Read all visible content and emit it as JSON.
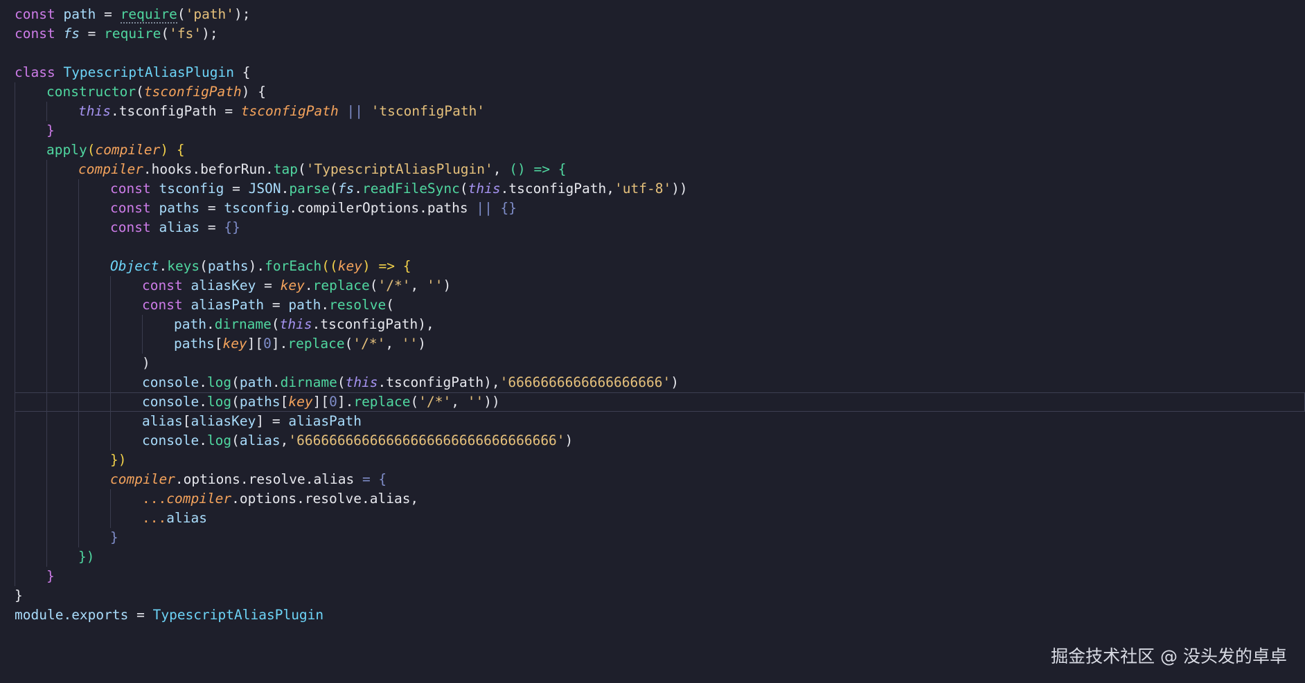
{
  "editor": {
    "language": "javascript",
    "highlighted_line": 20,
    "colors": {
      "background": "#1e1f2b",
      "keyword": "#cd7ce8",
      "string": "#e5c07b",
      "function": "#50d7a0",
      "parameter": "#f4a35c",
      "variable": "#a9dcfb",
      "class": "#6dd4f7",
      "this": "#a593f0",
      "text": "#e7e8ee",
      "punctuation": "#7f8dc9",
      "bracket": "#f1d04a"
    },
    "lines": [
      {
        "indent": 0,
        "tokens": [
          {
            "t": "const ",
            "c": "keyword"
          },
          {
            "t": "path",
            "c": "variable"
          },
          {
            "t": " = ",
            "c": "text"
          },
          {
            "t": "require",
            "c": "function",
            "s": "squiggle"
          },
          {
            "t": "(",
            "c": "text"
          },
          {
            "t": "'path'",
            "c": "string"
          },
          {
            "t": ");",
            "c": "text"
          }
        ]
      },
      {
        "indent": 0,
        "tokens": [
          {
            "t": "const ",
            "c": "keyword"
          },
          {
            "t": "fs",
            "c": "variable",
            "s": "it"
          },
          {
            "t": " = ",
            "c": "text"
          },
          {
            "t": "require",
            "c": "function"
          },
          {
            "t": "(",
            "c": "text"
          },
          {
            "t": "'fs'",
            "c": "string"
          },
          {
            "t": ");",
            "c": "text"
          }
        ]
      },
      {
        "indent": 0,
        "tokens": []
      },
      {
        "indent": 0,
        "tokens": [
          {
            "t": "class ",
            "c": "keyword"
          },
          {
            "t": "TypescriptAliasPlugin",
            "c": "class"
          },
          {
            "t": " {",
            "c": "text"
          }
        ]
      },
      {
        "indent": 1,
        "tokens": [
          {
            "t": "constructor",
            "c": "function"
          },
          {
            "t": "(",
            "c": "text"
          },
          {
            "t": "tsconfigPath",
            "c": "parameter",
            "s": "it"
          },
          {
            "t": ") {",
            "c": "text"
          }
        ]
      },
      {
        "indent": 2,
        "tokens": [
          {
            "t": "this",
            "c": "this",
            "s": "it"
          },
          {
            "t": ".tsconfigPath",
            "c": "text"
          },
          {
            "t": " = ",
            "c": "text"
          },
          {
            "t": "tsconfigPath",
            "c": "parameter",
            "s": "it"
          },
          {
            "t": " || ",
            "c": "punctuation"
          },
          {
            "t": "'tsconfigPath'",
            "c": "string"
          }
        ]
      },
      {
        "indent": 1,
        "tokens": [
          {
            "t": "}",
            "c": "keyword"
          }
        ]
      },
      {
        "indent": 1,
        "tokens": [
          {
            "t": "apply",
            "c": "function"
          },
          {
            "t": "(",
            "c": "bracket"
          },
          {
            "t": "compiler",
            "c": "parameter",
            "s": "it"
          },
          {
            "t": ") {",
            "c": "bracket"
          }
        ]
      },
      {
        "indent": 2,
        "tokens": [
          {
            "t": "compiler",
            "c": "parameter",
            "s": "it"
          },
          {
            "t": ".hooks.beforRun.",
            "c": "text"
          },
          {
            "t": "tap",
            "c": "function"
          },
          {
            "t": "(",
            "c": "text"
          },
          {
            "t": "'TypescriptAliasPlugin'",
            "c": "string"
          },
          {
            "t": ", ",
            "c": "text"
          },
          {
            "t": "() => {",
            "c": "function"
          }
        ]
      },
      {
        "indent": 3,
        "tokens": [
          {
            "t": "const ",
            "c": "keyword"
          },
          {
            "t": "tsconfig",
            "c": "variable"
          },
          {
            "t": " = ",
            "c": "text"
          },
          {
            "t": "JSON",
            "c": "variable"
          },
          {
            "t": ".",
            "c": "text"
          },
          {
            "t": "parse",
            "c": "function"
          },
          {
            "t": "(",
            "c": "text"
          },
          {
            "t": "fs",
            "c": "variable",
            "s": "it"
          },
          {
            "t": ".",
            "c": "text"
          },
          {
            "t": "readFileSync",
            "c": "function"
          },
          {
            "t": "(",
            "c": "text"
          },
          {
            "t": "this",
            "c": "this",
            "s": "it"
          },
          {
            "t": ".tsconfigPath,",
            "c": "text"
          },
          {
            "t": "'utf-8'",
            "c": "string"
          },
          {
            "t": "))",
            "c": "text"
          }
        ]
      },
      {
        "indent": 3,
        "tokens": [
          {
            "t": "const ",
            "c": "keyword"
          },
          {
            "t": "paths",
            "c": "variable"
          },
          {
            "t": " = ",
            "c": "text"
          },
          {
            "t": "tsconfig",
            "c": "variable"
          },
          {
            "t": ".compilerOptions.paths",
            "c": "text"
          },
          {
            "t": " || {}",
            "c": "punctuation"
          }
        ]
      },
      {
        "indent": 3,
        "tokens": [
          {
            "t": "const ",
            "c": "keyword"
          },
          {
            "t": "alias",
            "c": "variable"
          },
          {
            "t": " = ",
            "c": "text"
          },
          {
            "t": "{}",
            "c": "punctuation"
          }
        ]
      },
      {
        "indent": 0,
        "tokens": []
      },
      {
        "indent": 3,
        "tokens": [
          {
            "t": "Object",
            "c": "class",
            "s": "it"
          },
          {
            "t": ".",
            "c": "text"
          },
          {
            "t": "keys",
            "c": "function"
          },
          {
            "t": "(",
            "c": "text"
          },
          {
            "t": "paths",
            "c": "variable"
          },
          {
            "t": ").",
            "c": "text"
          },
          {
            "t": "forEach",
            "c": "function"
          },
          {
            "t": "((",
            "c": "bracket"
          },
          {
            "t": "key",
            "c": "parameter",
            "s": "it"
          },
          {
            "t": ") => {",
            "c": "bracket"
          }
        ]
      },
      {
        "indent": 4,
        "tokens": [
          {
            "t": "const ",
            "c": "keyword"
          },
          {
            "t": "aliasKey",
            "c": "variable"
          },
          {
            "t": " = ",
            "c": "text"
          },
          {
            "t": "key",
            "c": "parameter",
            "s": "it"
          },
          {
            "t": ".",
            "c": "text"
          },
          {
            "t": "replace",
            "c": "function"
          },
          {
            "t": "(",
            "c": "text"
          },
          {
            "t": "'/*'",
            "c": "string"
          },
          {
            "t": ", ",
            "c": "text"
          },
          {
            "t": "''",
            "c": "string"
          },
          {
            "t": ")",
            "c": "text"
          }
        ]
      },
      {
        "indent": 4,
        "tokens": [
          {
            "t": "const ",
            "c": "keyword"
          },
          {
            "t": "aliasPath",
            "c": "variable"
          },
          {
            "t": " = ",
            "c": "text"
          },
          {
            "t": "path",
            "c": "variable"
          },
          {
            "t": ".",
            "c": "text"
          },
          {
            "t": "resolve",
            "c": "function"
          },
          {
            "t": "(",
            "c": "text"
          }
        ]
      },
      {
        "indent": 5,
        "tokens": [
          {
            "t": "path",
            "c": "variable"
          },
          {
            "t": ".",
            "c": "text"
          },
          {
            "t": "dirname",
            "c": "function"
          },
          {
            "t": "(",
            "c": "text"
          },
          {
            "t": "this",
            "c": "this",
            "s": "it"
          },
          {
            "t": ".tsconfigPath",
            "c": "text"
          },
          {
            "t": "),",
            "c": "text"
          }
        ]
      },
      {
        "indent": 5,
        "tokens": [
          {
            "t": "paths",
            "c": "variable"
          },
          {
            "t": "[",
            "c": "text"
          },
          {
            "t": "key",
            "c": "parameter",
            "s": "it"
          },
          {
            "t": "][",
            "c": "text"
          },
          {
            "t": "0",
            "c": "punctuation"
          },
          {
            "t": "].",
            "c": "text"
          },
          {
            "t": "replace",
            "c": "function"
          },
          {
            "t": "(",
            "c": "text"
          },
          {
            "t": "'/*'",
            "c": "string"
          },
          {
            "t": ", ",
            "c": "text"
          },
          {
            "t": "''",
            "c": "string"
          },
          {
            "t": ")",
            "c": "text"
          }
        ]
      },
      {
        "indent": 4,
        "tokens": [
          {
            "t": ")",
            "c": "text"
          }
        ]
      },
      {
        "indent": 4,
        "tokens": [
          {
            "t": "console",
            "c": "variable"
          },
          {
            "t": ".",
            "c": "text"
          },
          {
            "t": "log",
            "c": "function"
          },
          {
            "t": "(",
            "c": "text"
          },
          {
            "t": "path",
            "c": "variable"
          },
          {
            "t": ".",
            "c": "text"
          },
          {
            "t": "dirname",
            "c": "function"
          },
          {
            "t": "(",
            "c": "text"
          },
          {
            "t": "this",
            "c": "this",
            "s": "it"
          },
          {
            "t": ".tsconfigPath",
            "c": "text"
          },
          {
            "t": "),",
            "c": "text"
          },
          {
            "t": "'6666666666666666666'",
            "c": "string"
          },
          {
            "t": ")",
            "c": "text"
          }
        ]
      },
      {
        "indent": 4,
        "tokens": [
          {
            "t": "console",
            "c": "variable"
          },
          {
            "t": ".",
            "c": "text"
          },
          {
            "t": "log",
            "c": "function"
          },
          {
            "t": "(",
            "c": "text"
          },
          {
            "t": "paths",
            "c": "variable"
          },
          {
            "t": "[",
            "c": "text"
          },
          {
            "t": "key",
            "c": "parameter",
            "s": "it"
          },
          {
            "t": "][",
            "c": "text"
          },
          {
            "t": "0",
            "c": "punctuation"
          },
          {
            "t": "].",
            "c": "text"
          },
          {
            "t": "replace",
            "c": "function"
          },
          {
            "t": "(",
            "c": "text"
          },
          {
            "t": "'/*'",
            "c": "string"
          },
          {
            "t": ", ",
            "c": "text"
          },
          {
            "t": "''",
            "c": "string"
          },
          {
            "t": "))",
            "c": "text"
          }
        ]
      },
      {
        "indent": 4,
        "tokens": [
          {
            "t": "alias",
            "c": "variable"
          },
          {
            "t": "[",
            "c": "text"
          },
          {
            "t": "aliasKey",
            "c": "variable"
          },
          {
            "t": "]",
            "c": "text"
          },
          {
            "t": " = ",
            "c": "text"
          },
          {
            "t": "aliasPath",
            "c": "variable"
          }
        ]
      },
      {
        "indent": 4,
        "tokens": [
          {
            "t": "console",
            "c": "variable"
          },
          {
            "t": ".",
            "c": "text"
          },
          {
            "t": "log",
            "c": "function"
          },
          {
            "t": "(",
            "c": "text"
          },
          {
            "t": "alias",
            "c": "variable"
          },
          {
            "t": ",",
            "c": "text"
          },
          {
            "t": "'66666666666666666666666666666666'",
            "c": "string"
          },
          {
            "t": ")",
            "c": "text"
          }
        ]
      },
      {
        "indent": 3,
        "tokens": [
          {
            "t": "})",
            "c": "bracket"
          }
        ]
      },
      {
        "indent": 3,
        "tokens": [
          {
            "t": "compiler",
            "c": "parameter",
            "s": "it"
          },
          {
            "t": ".options.resolve.alias",
            "c": "text"
          },
          {
            "t": " = {",
            "c": "punctuation"
          }
        ]
      },
      {
        "indent": 4,
        "tokens": [
          {
            "t": "...",
            "c": "parameter"
          },
          {
            "t": "compiler",
            "c": "parameter",
            "s": "it"
          },
          {
            "t": ".options.resolve.alias,",
            "c": "text"
          }
        ]
      },
      {
        "indent": 4,
        "tokens": [
          {
            "t": "...",
            "c": "parameter"
          },
          {
            "t": "alias",
            "c": "variable"
          }
        ]
      },
      {
        "indent": 3,
        "tokens": [
          {
            "t": "}",
            "c": "punctuation"
          }
        ]
      },
      {
        "indent": 2,
        "tokens": [
          {
            "t": "})",
            "c": "function"
          }
        ]
      },
      {
        "indent": 1,
        "tokens": [
          {
            "t": "}",
            "c": "keyword"
          }
        ]
      },
      {
        "indent": 0,
        "tokens": [
          {
            "t": "}",
            "c": "text"
          }
        ]
      },
      {
        "indent": 0,
        "tokens": [
          {
            "t": "module",
            "c": "variable"
          },
          {
            "t": ".exports",
            "c": "variable"
          },
          {
            "t": " = ",
            "c": "text"
          },
          {
            "t": "TypescriptAliasPlugin",
            "c": "class"
          }
        ]
      }
    ]
  },
  "watermark": {
    "text": "掘金技术社区 @ 没头发的卓卓"
  }
}
